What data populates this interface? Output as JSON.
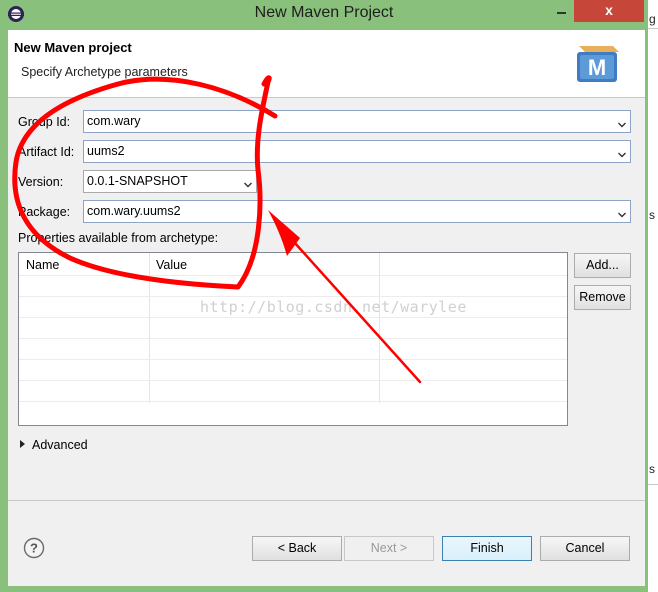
{
  "window": {
    "title": "New Maven Project",
    "close_glyph": "x"
  },
  "banner": {
    "title": "New Maven project",
    "subtitle": "Specify Archetype parameters",
    "logo_letter": "M"
  },
  "form": {
    "group_id_label": "Group Id:",
    "group_id_value": "com.wary",
    "artifact_id_label": "Artifact Id:",
    "artifact_id_value": "uums2",
    "version_label": "Version:",
    "version_value": "0.0.1-SNAPSHOT",
    "package_label": "Package:",
    "package_value": "com.wary.uums2",
    "properties_label": "Properties available from archetype:"
  },
  "table": {
    "columns": [
      "Name",
      "Value"
    ],
    "rows": []
  },
  "side_buttons": {
    "add": "Add...",
    "remove": "Remove"
  },
  "advanced": {
    "label": "Advanced",
    "expanded": false
  },
  "footer": {
    "back": "< Back",
    "next": "Next >",
    "finish": "Finish",
    "cancel": "Cancel"
  },
  "watermark": "http://blog.csdn.net/warylee",
  "background_fragments": [
    "g",
    "s",
    "s"
  ],
  "colors": {
    "frame": "#89c07c",
    "close": "#c7463a",
    "annotation": "#ff0000"
  },
  "icons": [
    "eclipse-icon",
    "maven-logo-icon",
    "help-icon",
    "chevron-down-icon",
    "expand-triangle-icon"
  ]
}
